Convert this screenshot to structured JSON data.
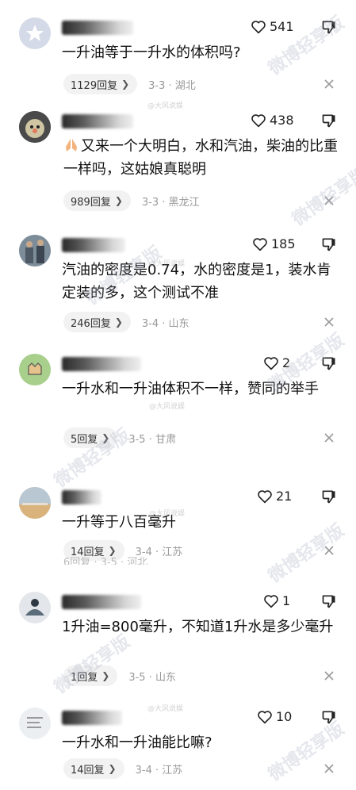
{
  "comments": [
    {
      "likes": "541",
      "text": "一升油等于一升水的体积吗?",
      "replies": "1129回复",
      "meta": "3-3 · 湖北"
    },
    {
      "likes": "438",
      "text": "又来一个大明白，水和汽油，柴油的比重一样吗，这姑娘真聪明",
      "replies": "989回复",
      "meta": "3-3 · 黑龙江"
    },
    {
      "likes": "185",
      "text": "汽油的密度是0.74，水的密度是1，装水肯定装的多，这个测试不准",
      "replies": "246回复",
      "meta": "3-4 · 山东"
    },
    {
      "likes": "2",
      "text": "一升水和一升油体积不一样，赞同的举手",
      "replies": "5回复",
      "meta": "3-5 · 甘肃"
    },
    {
      "likes": "21",
      "text": "一升等于八百毫升",
      "replies": "14回复",
      "meta": "3-4 · 江苏"
    },
    {
      "likes": "1",
      "text": "1升油=800毫升，不知道1升水是多少毫升",
      "replies": "1回复",
      "meta": "3-5 · 山东"
    },
    {
      "likes": "10",
      "text": "一升水和一升油能比嘛?",
      "replies": "14回复",
      "meta": "3-4 · 江苏"
    }
  ],
  "ghost_row": "6回复 · 3-5 · 河北",
  "watermark": {
    "big": "微博轻享版",
    "small": "@大风说娱"
  },
  "icons": {
    "like": "heart-outline-icon",
    "dislike": "thumbs-down-icon",
    "close": "close-icon",
    "chevron": "chevron-right-icon"
  },
  "colors": {
    "text": "#111111",
    "meta": "#999999",
    "pill_bg": "#f2f2f2"
  }
}
